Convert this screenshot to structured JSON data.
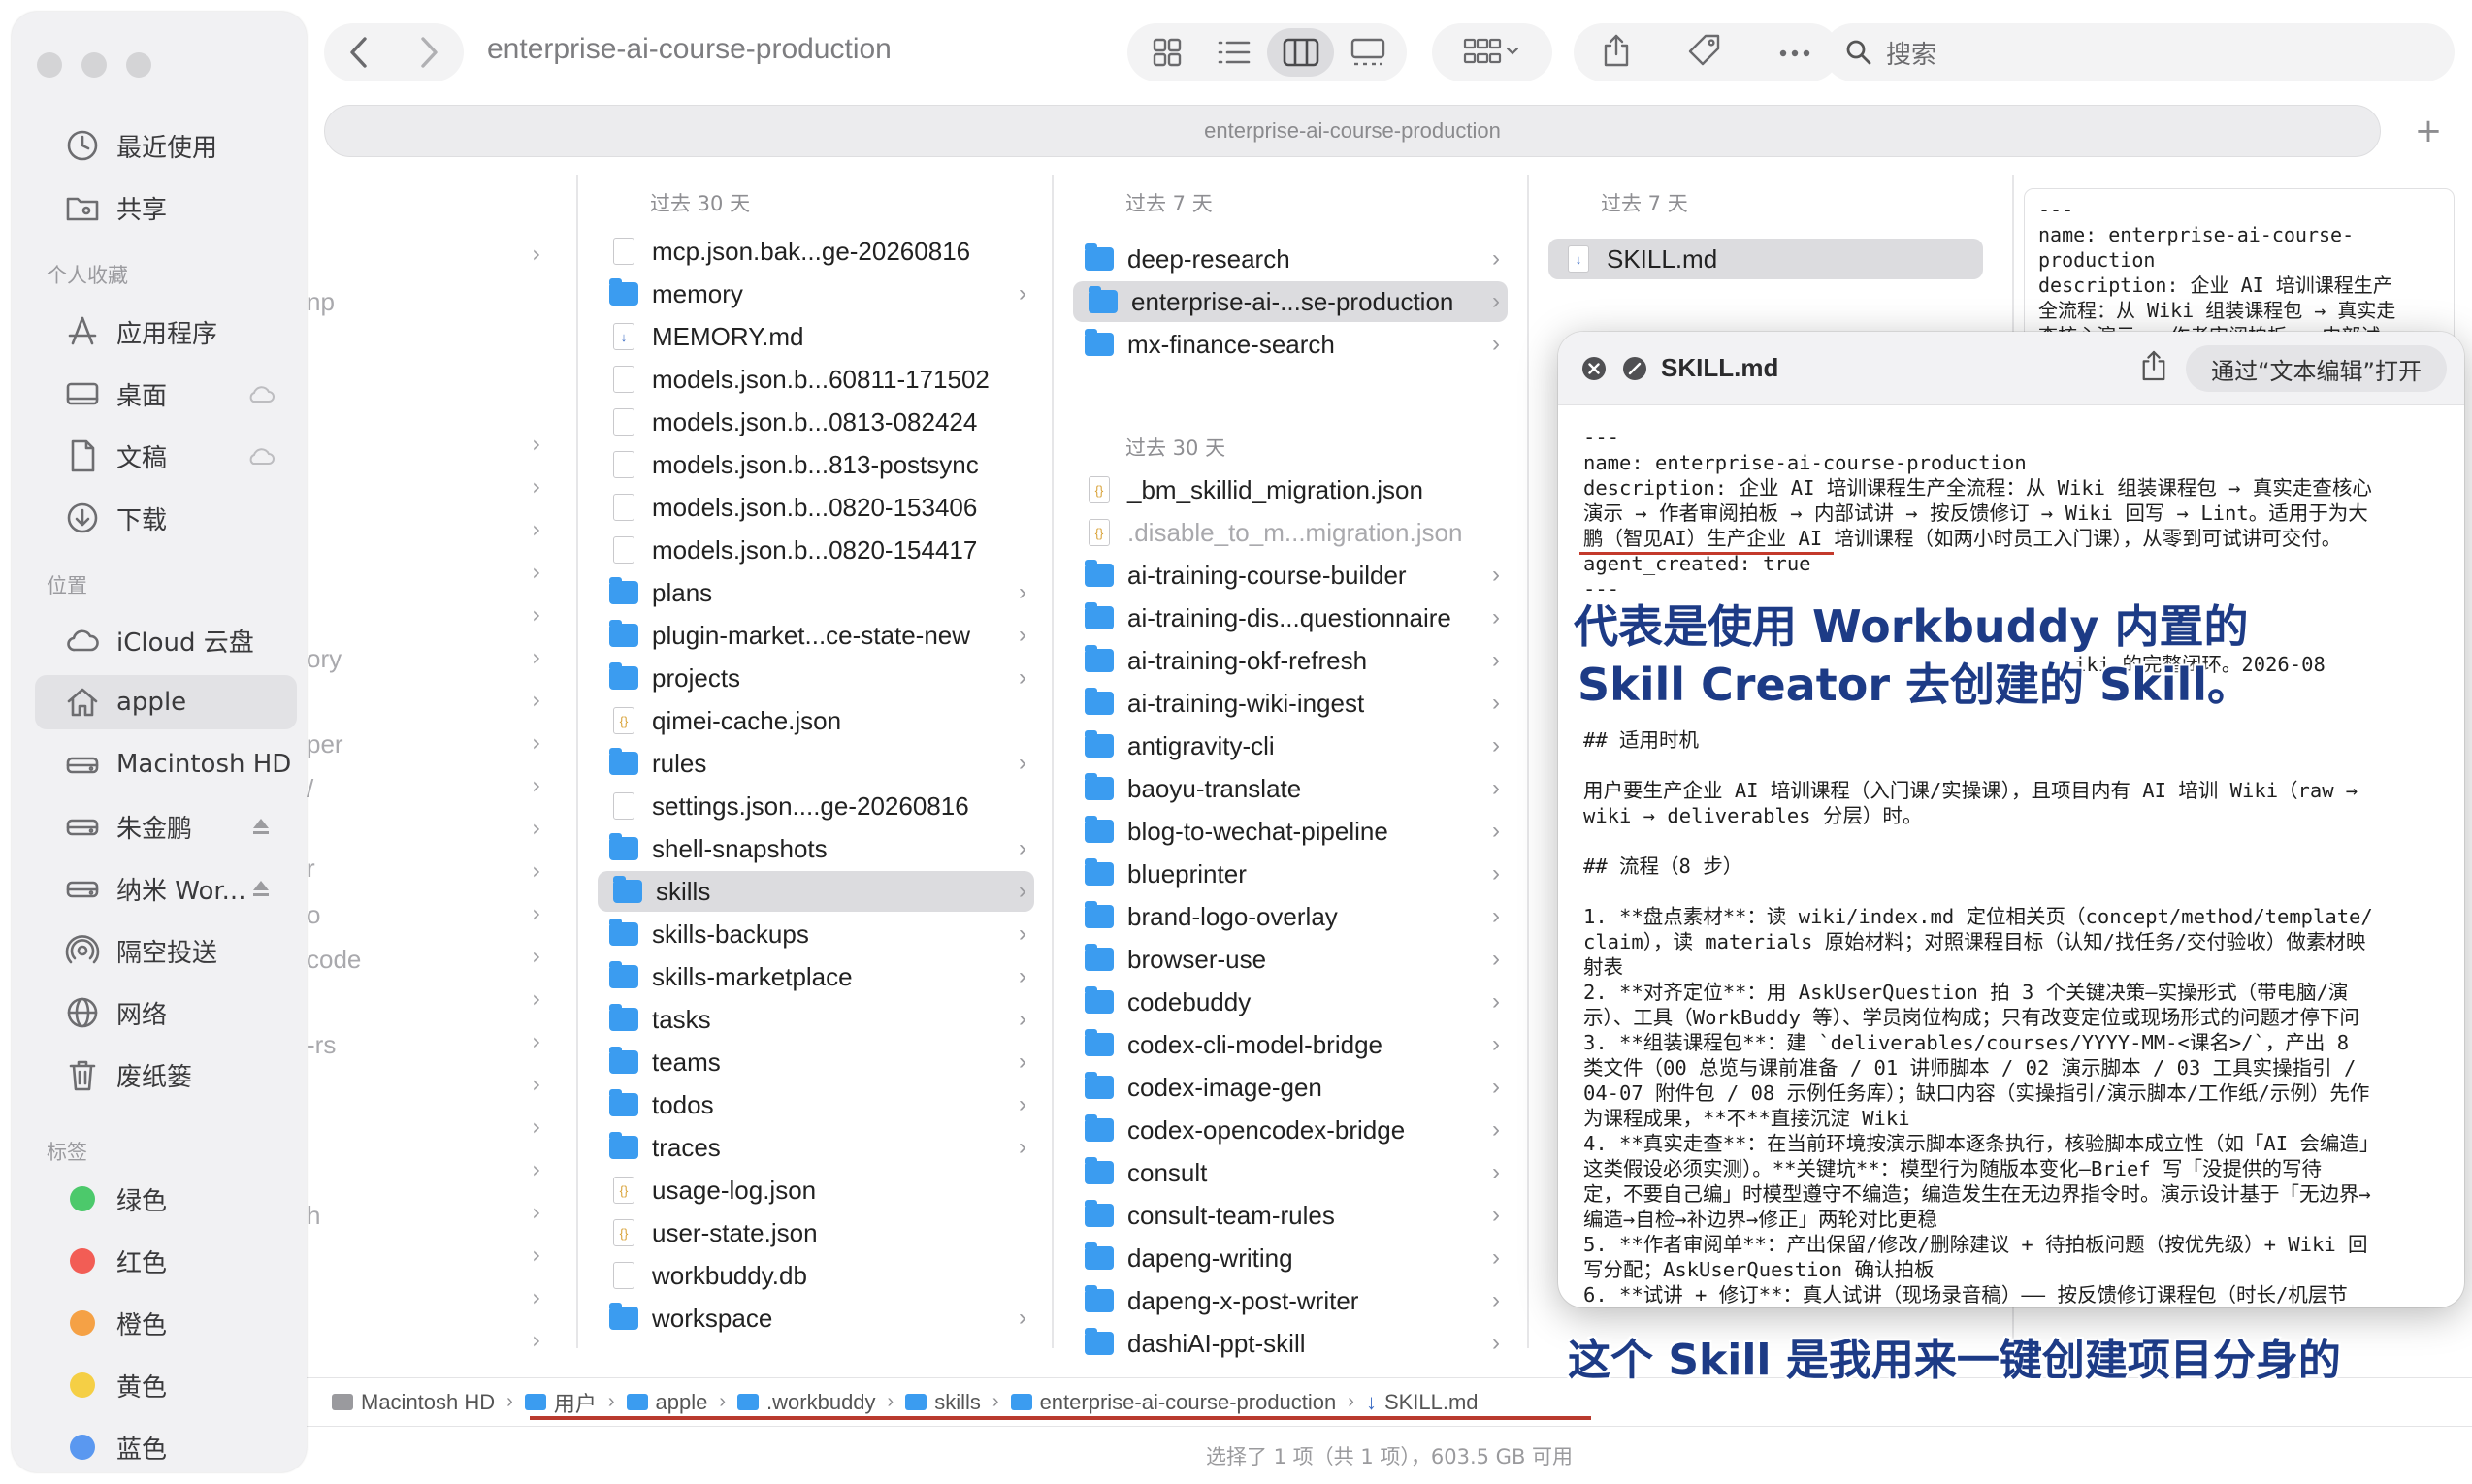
{
  "window": {
    "title": "enterprise-ai-course-production",
    "path_bar": "enterprise-ai-course-production",
    "search_placeholder": "搜索",
    "plus": "+"
  },
  "sidebar": {
    "top_items": [
      {
        "label": "最近使用",
        "icon": "clock-icon"
      },
      {
        "label": "共享",
        "icon": "shared-folder-icon"
      }
    ],
    "favorites_header": "个人收藏",
    "favorites": [
      {
        "label": "应用程序",
        "icon": "apps-icon"
      },
      {
        "label": "桌面",
        "icon": "desktop-icon",
        "right": "cloud-icon"
      },
      {
        "label": "文稿",
        "icon": "document-icon",
        "right": "cloud-icon"
      },
      {
        "label": "下载",
        "icon": "download-icon"
      }
    ],
    "locations_header": "位置",
    "locations": [
      {
        "label": "iCloud 云盘",
        "icon": "icloud-icon"
      },
      {
        "label": "apple",
        "icon": "home-icon",
        "active": true
      },
      {
        "label": "Macintosh HD",
        "icon": "disk-icon"
      },
      {
        "label": "朱金鹏",
        "icon": "disk-icon",
        "right": "eject-icon"
      },
      {
        "label": "纳米 Wor...",
        "icon": "disk-icon",
        "right": "eject-icon"
      },
      {
        "label": "隔空投送",
        "icon": "airdrop-icon"
      },
      {
        "label": "网络",
        "icon": "globe-icon"
      },
      {
        "label": "废纸篓",
        "icon": "trash-icon"
      }
    ],
    "tags_header": "标签",
    "tags": [
      {
        "label": "绿色",
        "color": "#4cc96b"
      },
      {
        "label": "红色",
        "color": "#f25d55"
      },
      {
        "label": "橙色",
        "color": "#f5a145"
      },
      {
        "label": "黄色",
        "color": "#f5cf45"
      },
      {
        "label": "蓝色",
        "color": "#5a98f0"
      }
    ]
  },
  "left_fragments": [
    "np",
    "ory",
    "per",
    "/",
    "r",
    "o",
    "code",
    "-rs",
    "h"
  ],
  "column1": {
    "header": "过去 30 天",
    "items": [
      {
        "name": "mcp.json.bak...ge-20260816",
        "type": "file",
        "chev": false
      },
      {
        "name": "memory",
        "type": "folder",
        "chev": true
      },
      {
        "name": "MEMORY.md",
        "type": "md",
        "chev": false
      },
      {
        "name": "models.json.b...60811-171502",
        "type": "file",
        "chev": false
      },
      {
        "name": "models.json.b...0813-082424",
        "type": "file",
        "chev": false
      },
      {
        "name": "models.json.b...813-postsync",
        "type": "file",
        "chev": false
      },
      {
        "name": "models.json.b...0820-153406",
        "type": "file",
        "chev": false
      },
      {
        "name": "models.json.b...0820-154417",
        "type": "file",
        "chev": false
      },
      {
        "name": "plans",
        "type": "folder",
        "chev": true
      },
      {
        "name": "plugin-market...ce-state-new",
        "type": "folder",
        "chev": true
      },
      {
        "name": "projects",
        "type": "folder",
        "chev": true
      },
      {
        "name": "qimei-cache.json",
        "type": "json",
        "chev": false
      },
      {
        "name": "rules",
        "type": "folder",
        "chev": true
      },
      {
        "name": "settings.json....ge-20260816",
        "type": "file",
        "chev": false
      },
      {
        "name": "shell-snapshots",
        "type": "folder",
        "chev": true
      },
      {
        "name": "skills",
        "type": "folder",
        "chev": true,
        "selected": true
      },
      {
        "name": "skills-backups",
        "type": "folder",
        "chev": true
      },
      {
        "name": "skills-marketplace",
        "type": "folder",
        "chev": true
      },
      {
        "name": "tasks",
        "type": "folder",
        "chev": true
      },
      {
        "name": "teams",
        "type": "folder",
        "chev": true
      },
      {
        "name": "todos",
        "type": "folder",
        "chev": true
      },
      {
        "name": "traces",
        "type": "folder",
        "chev": true
      },
      {
        "name": "usage-log.json",
        "type": "json",
        "chev": false
      },
      {
        "name": "user-state.json",
        "type": "json",
        "chev": false
      },
      {
        "name": "workbuddy.db",
        "type": "file",
        "chev": false
      },
      {
        "name": "workspace",
        "type": "folder",
        "chev": true
      }
    ]
  },
  "column2": {
    "header_recent": "过去 7 天",
    "recent": [
      {
        "name": "deep-research",
        "type": "folder",
        "chev": true
      },
      {
        "name": "enterprise-ai-...se-production",
        "type": "folder",
        "chev": true,
        "selected": true
      },
      {
        "name": "mx-finance-search",
        "type": "folder",
        "chev": true
      }
    ],
    "header_older": "过去 30 天",
    "older": [
      {
        "name": "_bm_skillid_migration.json",
        "type": "json",
        "chev": false
      },
      {
        "name": ".disable_to_m...migration.json",
        "type": "json",
        "chev": false,
        "dim": true
      },
      {
        "name": "ai-training-course-builder",
        "type": "folder",
        "chev": true
      },
      {
        "name": "ai-training-dis...questionnaire",
        "type": "folder",
        "chev": true
      },
      {
        "name": "ai-training-okf-refresh",
        "type": "folder",
        "chev": true
      },
      {
        "name": "ai-training-wiki-ingest",
        "type": "folder",
        "chev": true
      },
      {
        "name": "antigravity-cli",
        "type": "folder",
        "chev": true
      },
      {
        "name": "baoyu-translate",
        "type": "folder",
        "chev": true
      },
      {
        "name": "blog-to-wechat-pipeline",
        "type": "folder",
        "chev": true
      },
      {
        "name": "blueprinter",
        "type": "folder",
        "chev": true
      },
      {
        "name": "brand-logo-overlay",
        "type": "folder",
        "chev": true
      },
      {
        "name": "browser-use",
        "type": "folder",
        "chev": true
      },
      {
        "name": "codebuddy",
        "type": "folder",
        "chev": true
      },
      {
        "name": "codex-cli-model-bridge",
        "type": "folder",
        "chev": true
      },
      {
        "name": "codex-image-gen",
        "type": "folder",
        "chev": true
      },
      {
        "name": "codex-opencodex-bridge",
        "type": "folder",
        "chev": true
      },
      {
        "name": "consult",
        "type": "folder",
        "chev": true
      },
      {
        "name": "consult-team-rules",
        "type": "folder",
        "chev": true
      },
      {
        "name": "dapeng-writing",
        "type": "folder",
        "chev": true
      },
      {
        "name": "dapeng-x-post-writer",
        "type": "folder",
        "chev": true
      },
      {
        "name": "dashiAI-ppt-skill",
        "type": "folder",
        "chev": true
      }
    ]
  },
  "column3": {
    "header": "过去 7 天",
    "items": [
      {
        "name": "SKILL.md",
        "type": "md",
        "selected": true
      }
    ]
  },
  "preview_bg_text": "---\nname: enterprise-ai-course-\nproduction\ndescription: 企业 AI 培训课程生产\n全流程：从 Wiki 组装课程包 → 真实走\n查核心演示 → 作者审阅拍板 → 内部试",
  "quicklook": {
    "title": "SKILL.md",
    "open_with": "通过“文本编辑”打开",
    "lines": [
      "---",
      "name: enterprise-ai-course-production",
      "description: 企业 AI 培训课程生产全流程：从 Wiki 组装课程包 → 真实走查核心",
      "演示 → 作者审阅拍板 → 内部试讲 → 按反馈修订 → Wiki 回写 → Lint。适用于为大",
      "鹏（智见AI）生产企业 AI 培训课程（如两小时员工入门课），从零到可试讲可交付。",
      "agent_created: true",
      "---",
      "",
      "",
      "                                         iki 的完整闭环。2026-08",
      "",
      "",
      "## 适用时机",
      "",
      "用户要生产企业 AI 培训课程（入门课/实操课），且项目内有 AI 培训 Wiki（raw →",
      "wiki → deliverables 分层）时。",
      "",
      "## 流程（8 步）",
      "",
      "1. **盘点素材**：读 wiki/index.md 定位相关页（concept/method/template/",
      "claim），读 materials 原始材料；对照课程目标（认知/找任务/交付验收）做素材映",
      "射表",
      "2. **对齐定位**：用 AskUserQuestion 拍 3 个关键决策—实操形式（带电脑/演",
      "示）、工具（WorkBuddy 等）、学员岗位构成；只有改变定位或现场形式的问题才停下问",
      "3. **组装课程包**：建 `deliverables/courses/YYYY-MM-<课名>/`，产出 8",
      "类文件（00 总览与课前准备 / 01 讲师脚本 / 02 演示脚本 / 03 工具实操指引 /",
      "04-07 附件包 / 08 示例任务库）；缺口内容（实操指引/演示脚本/工作纸/示例）先作",
      "为课程成果，**不**直接沉淀 Wiki",
      "4. **真实走查**：在当前环境按演示脚本逐条执行，核验脚本成立性（如「AI 会编造」",
      "这类假设必须实测）。**关键坑**：模型行为随版本变化—Brief 写「没提供的写待",
      "定，不要自己编」时模型遵守不编造；编造发生在无边界指令时。演示设计基于「无边界→",
      "编造→自检→补边界→修正」两轮对比更稳",
      "5. **作者审阅单**：产出保留/修改/删除建议 + 待拍板问题（按优先级）+ Wiki 回",
      "写分配；AskUserQuestion 确认拍板",
      "6. **试讲 + 修订**：真人试讲（现场录音稿）—— 按反馈修订课程包（时长/机层节"
    ]
  },
  "captions": {
    "line1": "代表是使用 Workbuddy 内置的",
    "line2": "Skill Creator 去创建的 Skill。",
    "line3": "这个 Skill 是我用来一键创建项目分身的"
  },
  "breadcrumb": [
    {
      "label": "Macintosh HD",
      "icon": "disk"
    },
    {
      "label": "用户",
      "icon": "folder"
    },
    {
      "label": "apple",
      "icon": "home"
    },
    {
      "label": ".workbuddy",
      "icon": "folder"
    },
    {
      "label": "skills",
      "icon": "folder"
    },
    {
      "label": "enterprise-ai-course-production",
      "icon": "folder"
    },
    {
      "label": "SKILL.md",
      "icon": "md"
    }
  ],
  "status": "选择了 1 项（共 1 项），603.5 GB 可用",
  "colors": {
    "accent_folder": "#3b9cf0",
    "caption": "#1d3b86",
    "annotation": "#c3392b"
  }
}
